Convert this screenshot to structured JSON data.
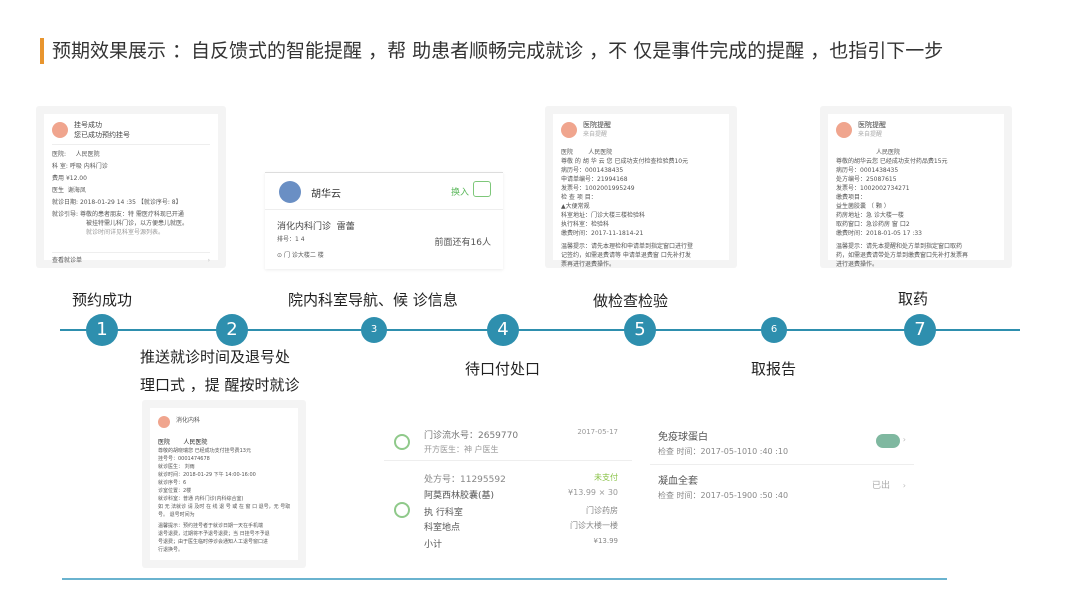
{
  "title": "预期效果展示 ：自反馈式的智能提醒 ，帮 助患者顺畅完成就诊 ，不 仅是事件完成的提醒 ，也指引下一步",
  "colors": {
    "accent": "#e8952e",
    "timeline": "#2e8fae",
    "bottom_line": "#6ab3cf"
  },
  "steps": [
    {
      "num": "1",
      "label": "预约成功"
    },
    {
      "num": "2",
      "label_line1": "推送就诊时间及退号处",
      "label_line2": "理口式 ，提 醒按时就诊"
    },
    {
      "num": "3",
      "label": "院内科室导航、候 诊信息"
    },
    {
      "num": "4",
      "label": "待口付处口"
    },
    {
      "num": "5",
      "label": "做检查检验"
    },
    {
      "num": "6",
      "label": "取报告"
    },
    {
      "num": "7",
      "label": "取药"
    }
  ],
  "card1": {
    "title": "挂号成功",
    "subtitle": "您已成功预约挂号",
    "hospital_label": "医院:",
    "hospital": "人民医院",
    "dept_label": "科 室:",
    "dept": "呼吸 内科门诊",
    "fee_label": "费用",
    "fee": "¥12.00",
    "doctor_label": "医生",
    "doctor": "谢海凤",
    "date_label": "就诊日期:",
    "date": "2018-01-29 14 :35 【就诊序号: 8】",
    "guide_label": "就诊引导:",
    "guide_line1": "尊敬的患者朋友：特 需医疗科现已开通",
    "guide_line2": "被挂特需儿科门诊，以方便患儿就医。",
    "guide_line3": "就诊时间详见科室号源列表。",
    "footer": "查看就诊单"
  },
  "card2": {
    "header": "消化内科",
    "hospital_label": "医院",
    "hospital": "人民医院",
    "lines": [
      "尊敬的胡晓瑞您 已经成功支付挂号费13元",
      "挂号号：0001474678",
      "就诊医生： 刘雨",
      "就诊时间：2018-01-29 下午 14:00-16:00",
      "就诊序号：6",
      "诊室位置：2楼",
      "就诊科室：普通 内科门诊(内科综合室)",
      "如 无 法就诊 请 及时 在 线 退 号 或 在 窗 口 退号，无 号取",
      "号。 退号时间为",
      "温馨提示：预约挂号者于就诊日期一天在手机端",
      "退号退费，过期将不予退号退费；当 日挂号不予退",
      "号退费；由于医生临时停诊会通知人工退号窗口进",
      "行退换号。"
    ]
  },
  "card3": {
    "name": "胡华云",
    "action": "换入",
    "dept": "消化内科门诊",
    "doctor": "雷蕾",
    "code": "排号：1 4",
    "queue": "前面还有16人",
    "location": "门 诊大楼二 楼"
  },
  "card5": {
    "title": "医院提醒",
    "subtitle": "来自提醒",
    "hospital_label": "医院",
    "hospital": "人民医院",
    "lines": [
      "尊敬 的 胡 华 云 您 已成功支付检查检验费10元",
      "病历号：0001438435",
      "申请单编号：21994168",
      "发票号：1002001995249",
      "检 查 项 目：",
      "▲大便常规",
      "科室地址：门诊大楼三楼检验科",
      "执行科室：检验科",
      "缴费时间：2017-11-1814-21"
    ],
    "tip1": "温馨提示：请先本理检和申请单到指定窗口进行登",
    "tip2": "记签约，如需退费请等 申请单退费窗 口先补打发",
    "tip3": "票再进行退费操作。"
  },
  "card7": {
    "title": "医院提醒",
    "subtitle": "来自提醒",
    "hospital": "人民医院",
    "lines": [
      "尊敬的胡华云您 已经成功支付药品费15元",
      "病历号：0001438435",
      "处方编号：25087615",
      "发票号：1002002734271",
      "缴费项目：",
      "益生菌胶囊 （ 颗 ）",
      "药房地址：急 诊大楼一楼",
      "取药窗口：急诊药房 窗 口2",
      "缴费时间：2018-01-05 17 :33"
    ],
    "tip1": "温馨提示：请先本提醒和处方单到指定窗口取药",
    "tip2": "药，如需退费请带处方单到缴费窗口先补打发票再",
    "tip3": "进行退费操作。"
  },
  "card4": {
    "row1_label": "门诊流水号：2659770",
    "row1_date": "2017-05-17",
    "row1_sub": "开方医生：神 户医生",
    "rx_label": "处方号：11295592",
    "status": "未支付",
    "drug": "阿莫西林胶囊(基)",
    "price": "¥13.99 × 30",
    "exec_label": "执 行科室",
    "exec_value": "门诊药房",
    "loc_label": "科室地点",
    "loc_value": "门诊大楼一楼",
    "subtotal_label": "小计",
    "subtotal_value": "¥13.99"
  },
  "card6": {
    "item1": "免疫球蛋白",
    "item1_time": "检查 时间：2017-05-1010 :40 :10",
    "item2": "凝血全套",
    "item2_time": "检查 时间：2017-05-1900 :50 :40",
    "item2_status": "已出"
  }
}
